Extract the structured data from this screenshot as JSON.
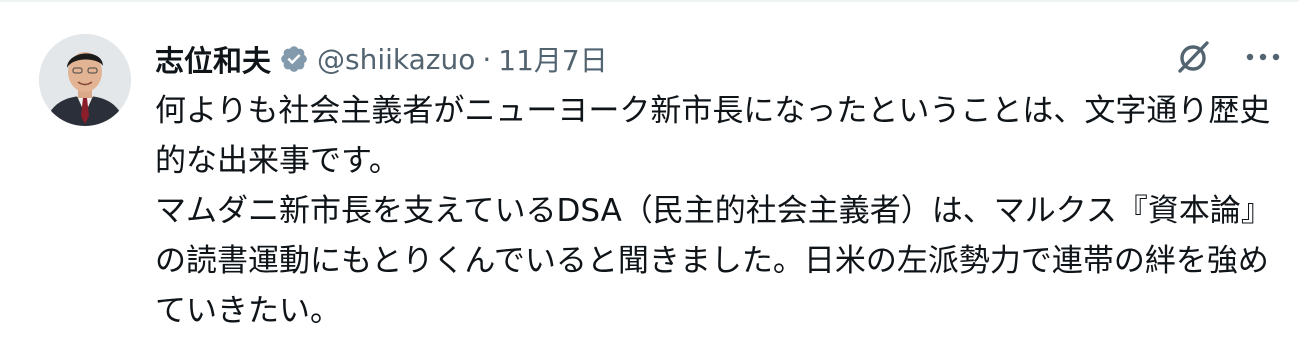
{
  "tweet": {
    "author": {
      "display_name": "志位和夫",
      "handle": "@shiikazuo",
      "verified": true,
      "verified_badge_color": "#829aab"
    },
    "separator": "·",
    "timestamp": "11月7日",
    "paragraphs": [
      "何よりも社会主義者がニューヨーク新市長になったということは、文字通り歴史的な出来事です。",
      "マムダニ新市長を支えているDSA（民主的社会主義者）は、マルクス『資本論』の読書運動にもとりくんでいると聞きました。日米の左派勢力で連帯の絆を強めていきたい。"
    ],
    "icons": {
      "verified": "verified-badge-icon",
      "grok": "grok-icon",
      "more": "more-icon"
    }
  }
}
